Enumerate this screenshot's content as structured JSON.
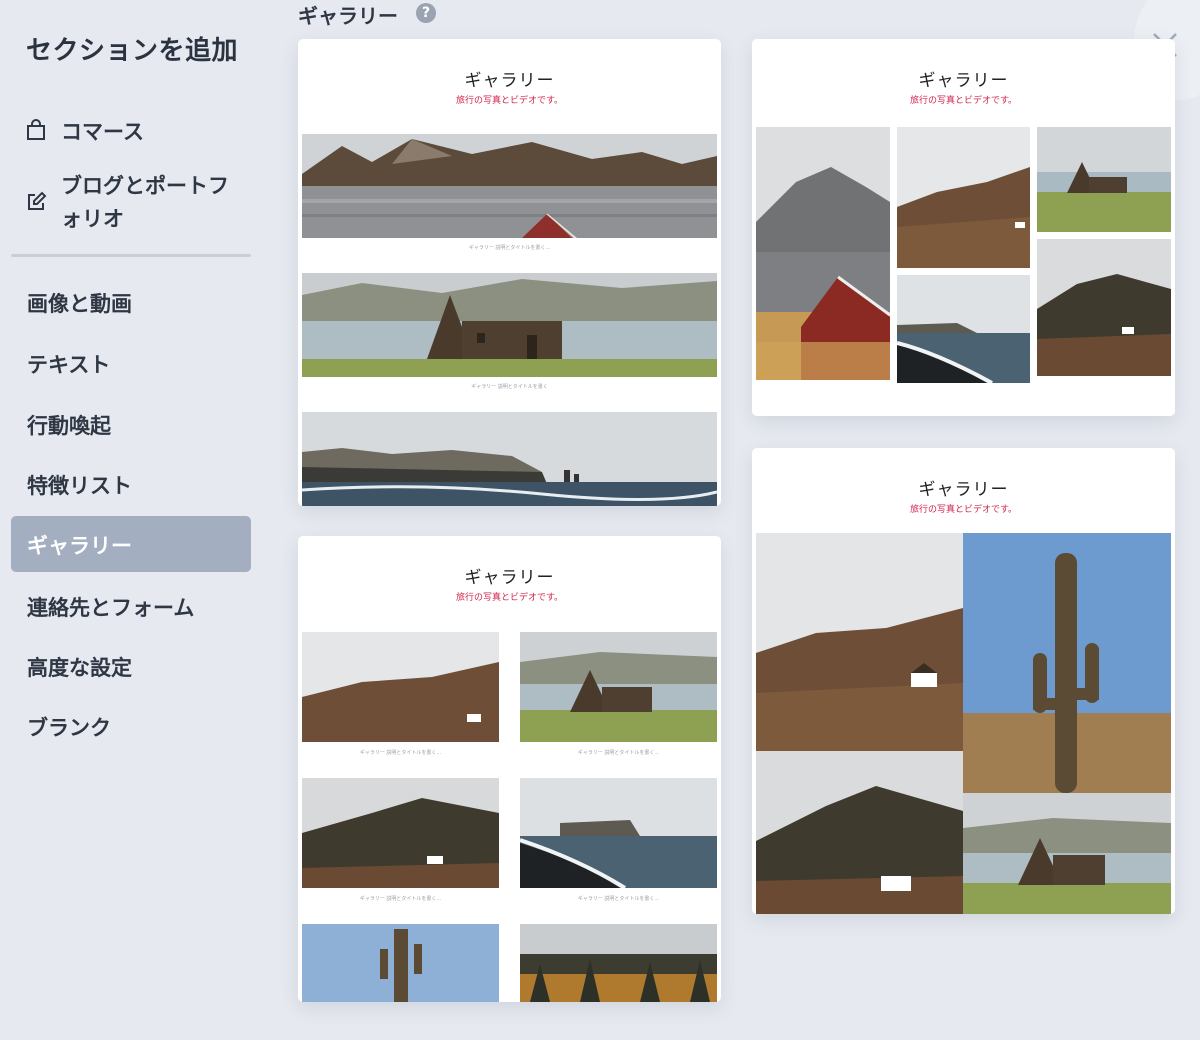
{
  "sidebar": {
    "title": "セクションを追加",
    "items": [
      {
        "label": "コマース",
        "icon": "shopping-bag-icon"
      },
      {
        "label_line1": "ブログとポートフ",
        "label_line2": "ォリオ",
        "icon": "edit-icon"
      },
      {
        "label": "画像と動画"
      },
      {
        "label": "テキスト"
      },
      {
        "label": "行動喚起"
      },
      {
        "label": "特徴リスト"
      },
      {
        "label": "ギャラリー",
        "active": true
      },
      {
        "label": "連絡先とフォーム"
      },
      {
        "label": "高度な設定"
      },
      {
        "label": "ブランク"
      }
    ]
  },
  "header": {
    "title": "ギャラリー",
    "help": "?"
  },
  "cards": [
    {
      "title": "ギャラリー",
      "subtitle": "旅行の写真とビデオです。",
      "captions": [
        "ギャラリー 説明とタイトルを書く...",
        "ギャラリー 説明とタイトルを書く"
      ]
    },
    {
      "title": "ギャラリー",
      "subtitle": "旅行の写真とビデオです。"
    },
    {
      "title": "ギャラリー",
      "subtitle": "旅行の写真とビデオです。",
      "captions": [
        "ギャラリー 説明とタイトルを書く...",
        "ギャラリー 説明とタイトルを書く...",
        "ギャラリー 説明とタイトルを書く...",
        "ギャラリー 説明とタイトルを書く..."
      ]
    },
    {
      "title": "ギャラリー",
      "subtitle": "旅行の写真とビデオです。"
    }
  ],
  "colors": {
    "background": "#e6e9f0",
    "active_item": "#a3aec0",
    "subtitle": "#d2254c"
  }
}
